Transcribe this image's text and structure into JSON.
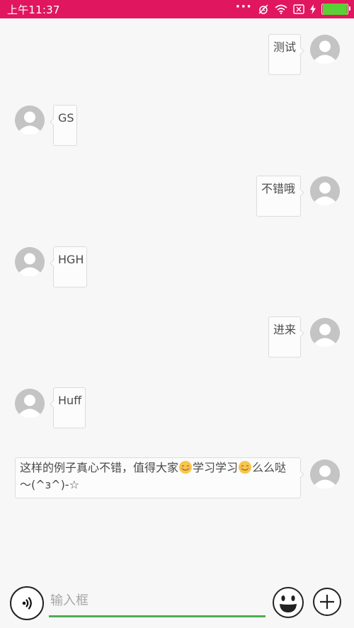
{
  "status_bar": {
    "time": "上午11:37",
    "icons": [
      "more-dots-icon",
      "alarm-off-icon",
      "wifi-icon",
      "sim-x-icon",
      "charging-bolt-icon",
      "battery-icon"
    ],
    "battery_level": 1.0,
    "colors": {
      "background": "#e0165e",
      "battery_fill": "#59d036"
    }
  },
  "chat": {
    "messages": [
      {
        "side": "right",
        "text": "测试"
      },
      {
        "side": "left",
        "text": "GS"
      },
      {
        "side": "right",
        "text": "不错哦"
      },
      {
        "side": "left",
        "text": "HGH"
      },
      {
        "side": "right",
        "text": "进来"
      },
      {
        "side": "left",
        "text": "Huff"
      },
      {
        "side": "right",
        "parts": [
          "这样的例子真心不错，值得大家",
          "学习学习",
          "么么哒",
          "～(^з^)-☆"
        ]
      }
    ]
  },
  "input_bar": {
    "placeholder": "输入框",
    "value": "",
    "voice_icon": "voice-input-icon",
    "emoji_icon": "smiley-face-icon",
    "plus_icon": "plus-icon",
    "underline_color": "#4caf50"
  }
}
